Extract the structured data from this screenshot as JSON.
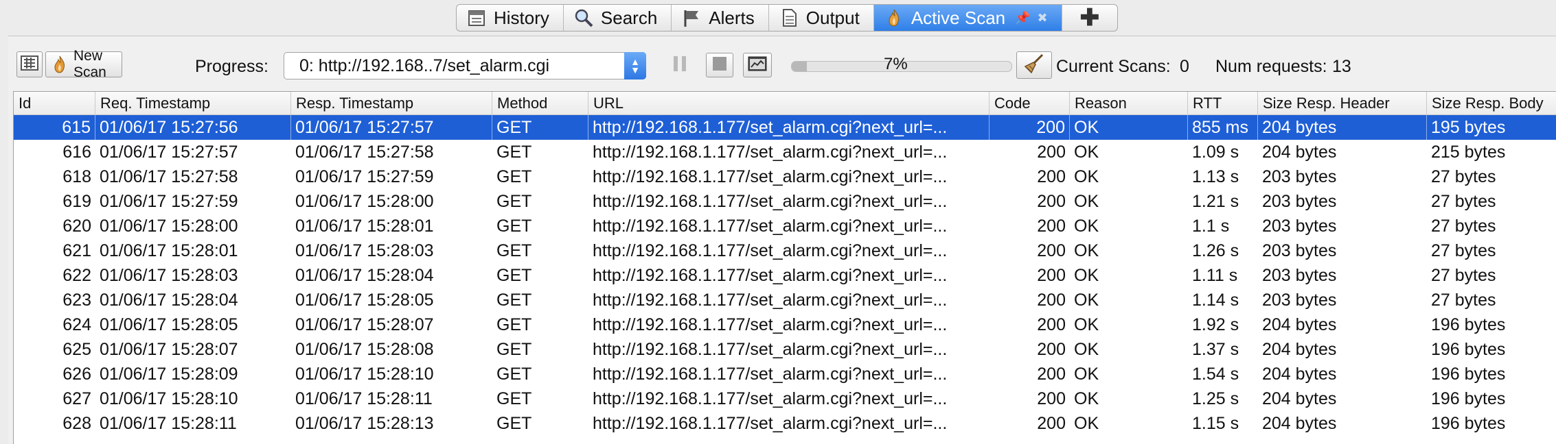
{
  "tabs": [
    {
      "label": "History",
      "icon": "history-icon"
    },
    {
      "label": "Search",
      "icon": "search-icon"
    },
    {
      "label": "Alerts",
      "icon": "alerts-flag-icon"
    },
    {
      "label": "Output",
      "icon": "output-document-icon"
    },
    {
      "label": "Active Scan",
      "icon": "active-scan-flame-icon",
      "active": true
    },
    {
      "label": "",
      "icon": "plus-icon"
    }
  ],
  "toolbar": {
    "new_scan_label": "New Scan",
    "progress_label": "Progress:",
    "progress_select_value": "0: http://192.168..7/set_alarm.cgi",
    "progress_percent_text": "7%",
    "progress_fraction": 0.07,
    "current_scans_label": "Current Scans:",
    "current_scans_value": "0",
    "num_requests_label": "Num requests:",
    "num_requests_value": "13"
  },
  "table": {
    "columns": [
      "Id",
      "Req. Timestamp",
      "Resp. Timestamp",
      "Method",
      "URL",
      "Code",
      "Reason",
      "RTT",
      "Size Resp. Header",
      "Size Resp. Body"
    ],
    "rows": [
      {
        "id": "615",
        "req": "01/06/17 15:27:56",
        "resp": "01/06/17 15:27:57",
        "method": "GET",
        "url": "http://192.168.1.177/set_alarm.cgi?next_url=...",
        "code": "200",
        "reason": "OK",
        "rtt": "855 ms",
        "hdr": "204 bytes",
        "body": "195 bytes",
        "selected": true
      },
      {
        "id": "616",
        "req": "01/06/17 15:27:57",
        "resp": "01/06/17 15:27:58",
        "method": "GET",
        "url": "http://192.168.1.177/set_alarm.cgi?next_url=...",
        "code": "200",
        "reason": "OK",
        "rtt": "1.09 s",
        "hdr": "204 bytes",
        "body": "215 bytes"
      },
      {
        "id": "618",
        "req": "01/06/17 15:27:58",
        "resp": "01/06/17 15:27:59",
        "method": "GET",
        "url": "http://192.168.1.177/set_alarm.cgi?next_url=...",
        "code": "200",
        "reason": "OK",
        "rtt": "1.13 s",
        "hdr": "203 bytes",
        "body": "27 bytes"
      },
      {
        "id": "619",
        "req": "01/06/17 15:27:59",
        "resp": "01/06/17 15:28:00",
        "method": "GET",
        "url": "http://192.168.1.177/set_alarm.cgi?next_url=...",
        "code": "200",
        "reason": "OK",
        "rtt": "1.21 s",
        "hdr": "203 bytes",
        "body": "27 bytes"
      },
      {
        "id": "620",
        "req": "01/06/17 15:28:00",
        "resp": "01/06/17 15:28:01",
        "method": "GET",
        "url": "http://192.168.1.177/set_alarm.cgi?next_url=...",
        "code": "200",
        "reason": "OK",
        "rtt": "1.1 s",
        "hdr": "203 bytes",
        "body": "27 bytes"
      },
      {
        "id": "621",
        "req": "01/06/17 15:28:01",
        "resp": "01/06/17 15:28:03",
        "method": "GET",
        "url": "http://192.168.1.177/set_alarm.cgi?next_url=...",
        "code": "200",
        "reason": "OK",
        "rtt": "1.26 s",
        "hdr": "203 bytes",
        "body": "27 bytes"
      },
      {
        "id": "622",
        "req": "01/06/17 15:28:03",
        "resp": "01/06/17 15:28:04",
        "method": "GET",
        "url": "http://192.168.1.177/set_alarm.cgi?next_url=...",
        "code": "200",
        "reason": "OK",
        "rtt": "1.11 s",
        "hdr": "203 bytes",
        "body": "27 bytes"
      },
      {
        "id": "623",
        "req": "01/06/17 15:28:04",
        "resp": "01/06/17 15:28:05",
        "method": "GET",
        "url": "http://192.168.1.177/set_alarm.cgi?next_url=...",
        "code": "200",
        "reason": "OK",
        "rtt": "1.14 s",
        "hdr": "203 bytes",
        "body": "27 bytes"
      },
      {
        "id": "624",
        "req": "01/06/17 15:28:05",
        "resp": "01/06/17 15:28:07",
        "method": "GET",
        "url": "http://192.168.1.177/set_alarm.cgi?next_url=...",
        "code": "200",
        "reason": "OK",
        "rtt": "1.92 s",
        "hdr": "204 bytes",
        "body": "196 bytes"
      },
      {
        "id": "625",
        "req": "01/06/17 15:28:07",
        "resp": "01/06/17 15:28:08",
        "method": "GET",
        "url": "http://192.168.1.177/set_alarm.cgi?next_url=...",
        "code": "200",
        "reason": "OK",
        "rtt": "1.37 s",
        "hdr": "204 bytes",
        "body": "196 bytes"
      },
      {
        "id": "626",
        "req": "01/06/17 15:28:09",
        "resp": "01/06/17 15:28:10",
        "method": "GET",
        "url": "http://192.168.1.177/set_alarm.cgi?next_url=...",
        "code": "200",
        "reason": "OK",
        "rtt": "1.54 s",
        "hdr": "204 bytes",
        "body": "196 bytes"
      },
      {
        "id": "627",
        "req": "01/06/17 15:28:10",
        "resp": "01/06/17 15:28:11",
        "method": "GET",
        "url": "http://192.168.1.177/set_alarm.cgi?next_url=...",
        "code": "200",
        "reason": "OK",
        "rtt": "1.25 s",
        "hdr": "204 bytes",
        "body": "196 bytes"
      },
      {
        "id": "628",
        "req": "01/06/17 15:28:11",
        "resp": "01/06/17 15:28:13",
        "method": "GET",
        "url": "http://192.168.1.177/set_alarm.cgi?next_url=...",
        "code": "200",
        "reason": "OK",
        "rtt": "1.15 s",
        "hdr": "204 bytes",
        "body": "196 bytes"
      }
    ]
  },
  "colors": {
    "selection": "#1e5fd6",
    "active_tab": "#2f7fe8"
  }
}
